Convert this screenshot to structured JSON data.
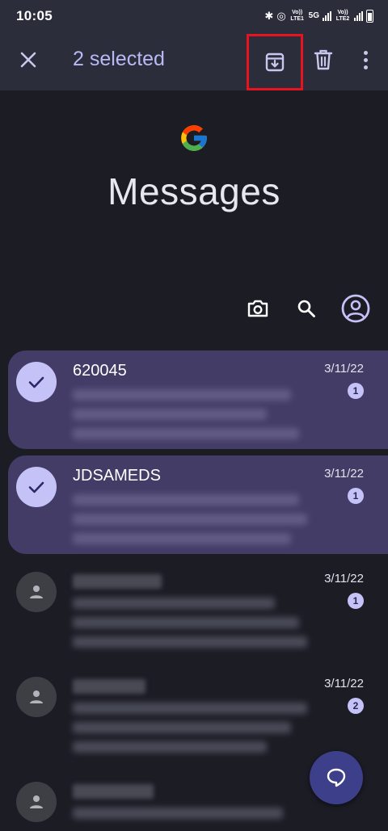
{
  "status_bar": {
    "time": "10:05",
    "icons": [
      "bluetooth-icon",
      "hotspot-icon",
      "volte-lte1-icon",
      "5g-icon",
      "signal-icon",
      "volte-lte2-icon",
      "signal-icon",
      "battery-icon"
    ],
    "volte1": "Vo)) LTE1",
    "net": "5G",
    "volte2": "Vo)) LTE2"
  },
  "action_bar": {
    "selected_label": "2 selected",
    "icons": [
      "close-icon",
      "archive-icon",
      "delete-icon",
      "more-vert-icon"
    ]
  },
  "header": {
    "app_title": "Messages",
    "logo": "google-g-logo"
  },
  "tools": [
    "camera-icon",
    "search-icon",
    "account-icon"
  ],
  "conversations": [
    {
      "name": "620045",
      "date": "3/11/22",
      "unread": "1",
      "selected": true
    },
    {
      "name": "JDSAMEDS",
      "date": "3/11/22",
      "unread": "1",
      "selected": true
    },
    {
      "name": "",
      "date": "3/11/22",
      "unread": "1",
      "selected": false
    },
    {
      "name": "",
      "date": "3/11/22",
      "unread": "2",
      "selected": false
    },
    {
      "name": "",
      "date": "",
      "unread": "",
      "selected": false
    }
  ],
  "fab": {
    "icon": "start-chat-icon"
  },
  "colors": {
    "background": "#1b1c24",
    "bar": "#2b2d3b",
    "selected_row": "#433c66",
    "accent": "#c4c2f7",
    "highlight_box": "#e8131f",
    "fab": "#3d3f8a"
  }
}
